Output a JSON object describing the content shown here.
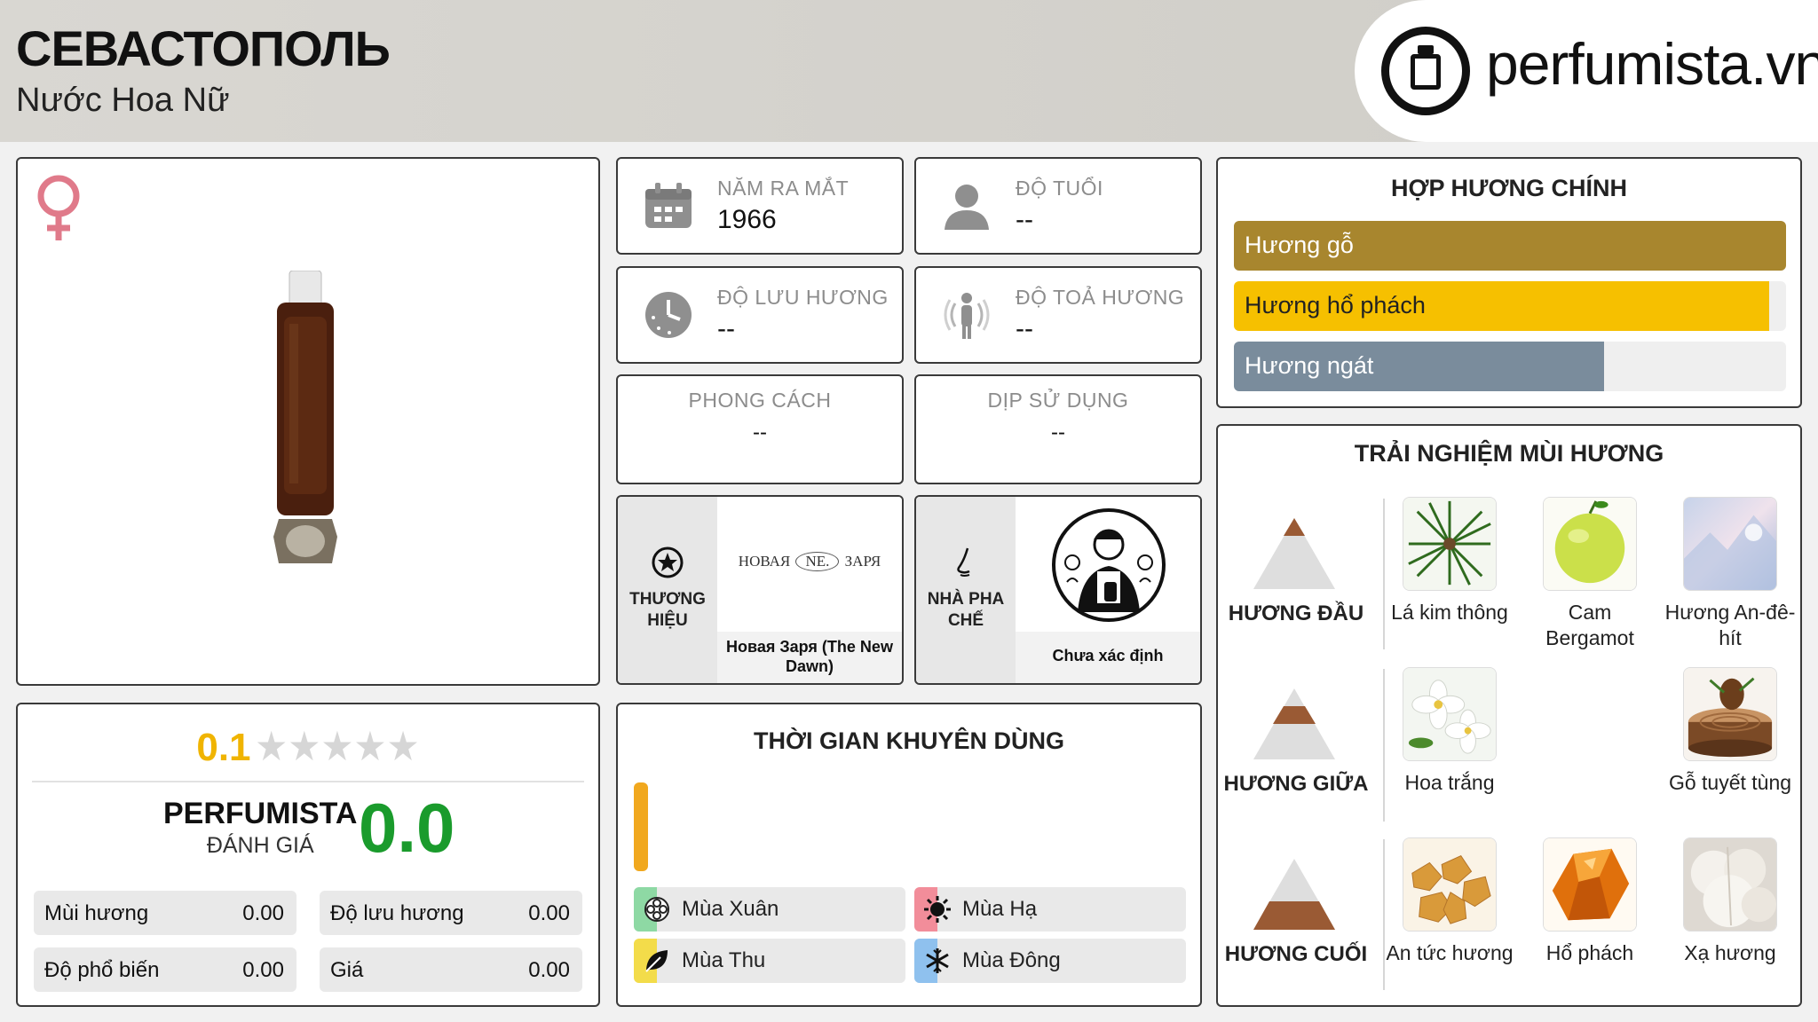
{
  "header": {
    "title": "СЕВАСТОПОЛЬ",
    "subtitle": "Nước Hoa Nữ",
    "logo_text": "perfumista.vn"
  },
  "rating": {
    "score": "0.1",
    "stars_total": 5,
    "perfumista_label": "PERFUMISTA",
    "perfumista_sub": "ĐÁNH GIÁ",
    "perfumista_score": "0.0",
    "metrics": [
      {
        "label": "Mùi hương",
        "value": "0.00"
      },
      {
        "label": "Độ lưu hương",
        "value": "0.00"
      },
      {
        "label": "Độ phổ biến",
        "value": "0.00"
      },
      {
        "label": "Giá",
        "value": "0.00"
      }
    ]
  },
  "info": {
    "launch_label": "NĂM RA MẮT",
    "launch_value": "1966",
    "age_label": "ĐỘ TUỔI",
    "age_value": "--",
    "longevity_label": "ĐỘ LƯU HƯƠNG",
    "longevity_value": "--",
    "sillage_label": "ĐỘ TOẢ HƯƠNG",
    "sillage_value": "--",
    "style_label": "PHONG CÁCH",
    "style_value": "--",
    "occasion_label": "DỊP SỬ DỤNG",
    "occasion_value": "--",
    "brand_label": "THƯƠNG HIỆU",
    "brand_logo_left": "НОВАЯ",
    "brand_logo_mid": "NE.",
    "brand_logo_right": "ЗАРЯ",
    "brand_name": "Новая Заря (The New Dawn)",
    "perfumer_label": "NHÀ PHA CHẾ",
    "perfumer_name": "Chưa xác định"
  },
  "accords": {
    "title": "HỢP HƯƠNG CHÍNH",
    "items": [
      {
        "label": "Hương gỗ",
        "level": 1.0,
        "color": "#a8862e"
      },
      {
        "label": "Hương hổ phách",
        "level": 0.97,
        "color": "#f6c000"
      },
      {
        "label": "Hương ngát",
        "level": 0.67,
        "color": "#7a8c9c"
      }
    ]
  },
  "seasons": {
    "title": "THỜI GIAN KHUYÊN DÙNG",
    "day_level": 0.05,
    "items": [
      {
        "label": "Mùa Xuân",
        "color": "#8ed9a4",
        "icon": "flower-icon"
      },
      {
        "label": "Mùa Hạ",
        "color": "#f28d9a",
        "icon": "sun-icon"
      },
      {
        "label": "Mùa Thu",
        "color": "#f3dc4a",
        "icon": "leaf-icon"
      },
      {
        "label": "Mùa Đông",
        "color": "#8fc1ee",
        "icon": "snowflake-icon"
      }
    ]
  },
  "notes": {
    "title": "TRẢI NGHIỆM MÙI HƯƠNG",
    "top_label": "HƯƠNG ĐẦU",
    "middle_label": "HƯƠNG GIỮA",
    "base_label": "HƯƠNG CUỐI",
    "top": [
      "Lá kim thông",
      "Cam Bergamot",
      "Hương An-đê-hít"
    ],
    "middle": [
      "Hoa trắng",
      "Gỗ tuyết tùng"
    ],
    "base": [
      "An tức hương",
      "Hổ phách",
      "Xạ hương"
    ]
  },
  "colors": {
    "accent_gold": "#f0b400",
    "score_green": "#1a9b2c",
    "venus_pink": "#e07a8a"
  }
}
